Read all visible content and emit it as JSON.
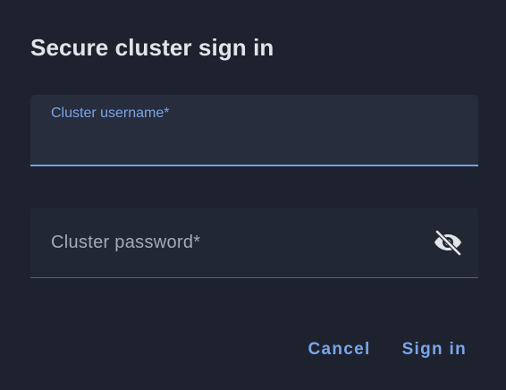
{
  "dialog": {
    "title": "Secure cluster sign in"
  },
  "username_field": {
    "label": "Cluster username*",
    "value": ""
  },
  "password_field": {
    "label": "Cluster password*",
    "value": "",
    "visibility_icon": "eye-off-icon"
  },
  "actions": {
    "cancel_label": "Cancel",
    "submit_label": "Sign in"
  },
  "colors": {
    "background": "#1d222e",
    "accent": "#79a6ea",
    "text": "#e2e4e9",
    "muted_text": "#a5a9b2"
  }
}
